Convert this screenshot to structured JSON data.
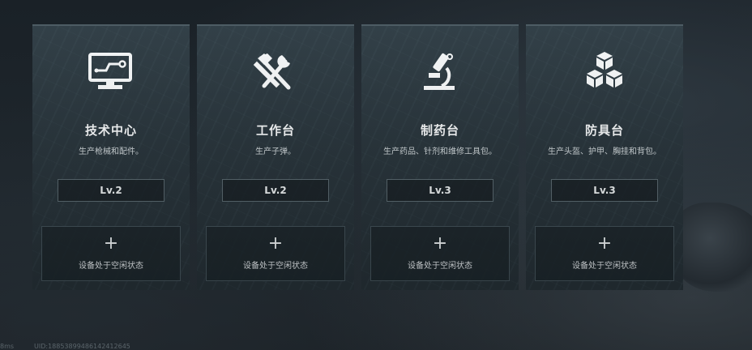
{
  "cards": [
    {
      "icon": "computer-monitor-icon",
      "title": "技术中心",
      "desc": "生产枪械和配件。",
      "level": "Lv.2",
      "slot": {
        "plus": "+",
        "label": "设备处于空闲状态"
      }
    },
    {
      "icon": "hammer-wrench-icon",
      "title": "工作台",
      "desc": "生产子弹。",
      "level": "Lv.2",
      "slot": {
        "plus": "+",
        "label": "设备处于空闲状态"
      }
    },
    {
      "icon": "microscope-icon",
      "title": "制药台",
      "desc": "生产药品、针剂和维修工具包。",
      "level": "Lv.3",
      "slot": {
        "plus": "+",
        "label": "设备处于空闲状态"
      }
    },
    {
      "icon": "cubes-stack-icon",
      "title": "防具台",
      "desc": "生产头盔、护甲、胸挂和背包。",
      "level": "Lv.3",
      "slot": {
        "plus": "+",
        "label": "设备处于空闲状态"
      }
    }
  ],
  "footer": {
    "ms": "8ms",
    "uid": "UID:18853899486142412645"
  },
  "colors": {
    "background": "#1b2228",
    "card": "#283439",
    "text": "#f2f4f5",
    "border": "#56646b"
  }
}
